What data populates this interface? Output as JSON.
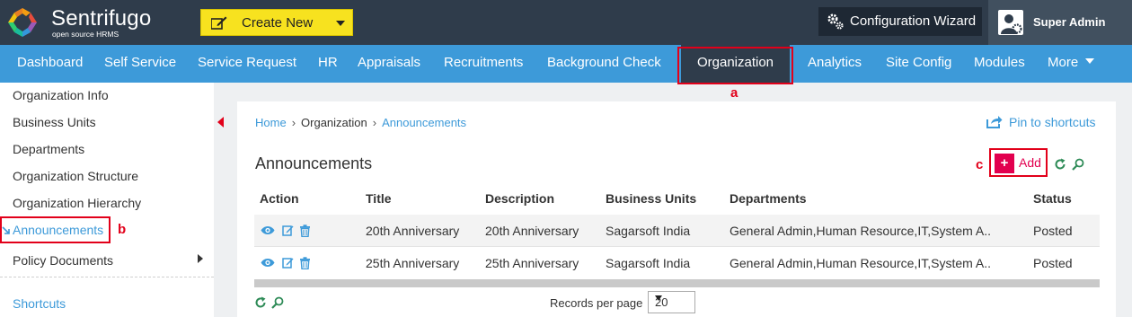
{
  "header": {
    "logo_title": "Sentrifugo",
    "logo_subtitle": "open source HRMS",
    "create_new_label": "Create New",
    "configuration_wizard_label": "Configuration Wizard",
    "user_name": "Super Admin"
  },
  "nav": {
    "items": [
      {
        "label": "Dashboard"
      },
      {
        "label": "Self Service"
      },
      {
        "label": "Service Request"
      },
      {
        "label": "HR"
      },
      {
        "label": "Appraisals"
      },
      {
        "label": "Recruitments"
      },
      {
        "label": "Background Check"
      },
      {
        "label": "Organization",
        "active": true
      },
      {
        "label": "Analytics"
      },
      {
        "label": "Site Config"
      },
      {
        "label": "Modules"
      },
      {
        "label": "More"
      }
    ]
  },
  "sidebar": {
    "items": [
      {
        "label": "Organization Info"
      },
      {
        "label": "Business Units"
      },
      {
        "label": "Departments"
      },
      {
        "label": "Organization Structure"
      },
      {
        "label": "Organization Hierarchy"
      },
      {
        "label": "Announcements",
        "active": true
      },
      {
        "label": "Policy Documents"
      }
    ],
    "shortcuts_label": "Shortcuts"
  },
  "annotations": {
    "a": "a",
    "b": "b",
    "c": "c"
  },
  "breadcrumb": {
    "home": "Home",
    "section": "Organization",
    "current": "Announcements"
  },
  "pin_label": "Pin to shortcuts",
  "page_title": "Announcements",
  "add_label": "Add",
  "add_plus": "+",
  "table": {
    "columns": [
      "Action",
      "Title",
      "Description",
      "Business Units",
      "Departments",
      "Status"
    ],
    "rows": [
      {
        "title": "20th Anniversary",
        "description": "20th Anniversary",
        "business_units": "Sagarsoft India",
        "departments": "General Admin,Human Resource,IT,System A..",
        "status": "Posted"
      },
      {
        "title": "25th Anniversary",
        "description": "25th Anniversary",
        "business_units": "Sagarsoft India",
        "departments": "General Admin,Human Resource,IT,System A..",
        "status": "Posted"
      }
    ]
  },
  "records_per_page_label": "Records per page",
  "records_per_page_value": "20",
  "colors": {
    "topbar": "#2f3c4b",
    "nav": "#3d9ad9",
    "accent_yellow": "#f7e21f",
    "highlight_red": "#e2001a",
    "add_pink": "#e2004f",
    "link_blue": "#3d9ad9"
  }
}
